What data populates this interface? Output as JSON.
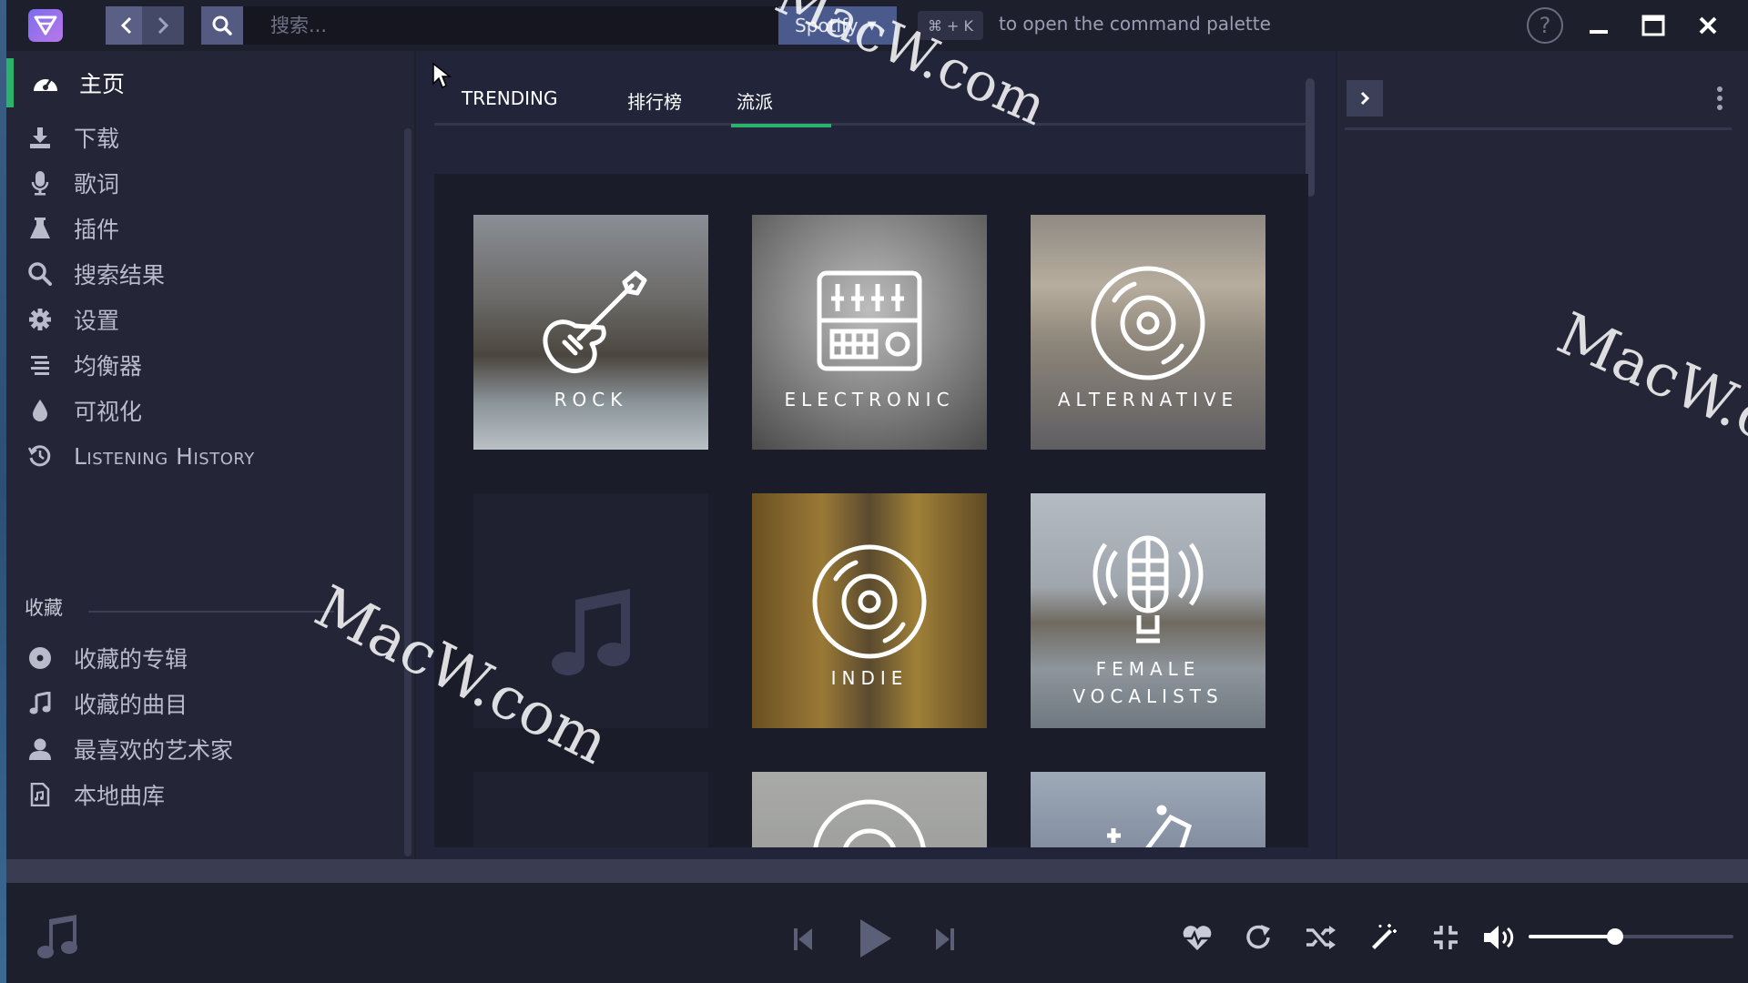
{
  "topbar": {
    "search_placeholder": "搜索...",
    "provider": "Spotify",
    "shortcut": "⌘ + K",
    "palette_hint": "to open the command palette",
    "help_symbol": "?"
  },
  "sidebar": {
    "items": [
      {
        "label": "主页",
        "icon": "dashboard-icon",
        "active": true
      },
      {
        "label": "下载",
        "icon": "download-icon"
      },
      {
        "label": "歌词",
        "icon": "microphone-icon"
      },
      {
        "label": "插件",
        "icon": "flask-icon"
      },
      {
        "label": "搜索结果",
        "icon": "search-icon"
      },
      {
        "label": "设置",
        "icon": "gear-icon"
      },
      {
        "label": "均衡器",
        "icon": "equalizer-icon"
      },
      {
        "label": "可视化",
        "icon": "droplet-icon"
      },
      {
        "label": "Listening History",
        "icon": "history-icon"
      }
    ],
    "favorites_header": "收藏",
    "favorites": [
      {
        "label": "收藏的专辑",
        "icon": "disc-icon"
      },
      {
        "label": "收藏的曲目",
        "icon": "music-note-icon"
      },
      {
        "label": "最喜欢的艺术家",
        "icon": "user-icon"
      },
      {
        "label": "本地曲库",
        "icon": "file-audio-icon"
      }
    ]
  },
  "tabs": [
    {
      "label": "TRENDING"
    },
    {
      "label": "排行榜"
    },
    {
      "label": "流派",
      "active": true
    }
  ],
  "genres": [
    {
      "label": "ROCK",
      "icon": "guitar-icon"
    },
    {
      "label": "ELECTRONIC",
      "icon": "mixer-icon"
    },
    {
      "label": "ALTERNATIVE",
      "icon": "vinyl-icon"
    },
    {
      "label": "INDIE",
      "icon": "vinyl-icon"
    },
    {
      "label": "FEMALE",
      "label2": "VOCALISTS",
      "icon": "microphone-icon"
    }
  ],
  "player": {
    "volume": 0.42
  },
  "colors": {
    "accent": "#2ab36b",
    "background": "#1e2030",
    "sidebar": "#242638"
  },
  "watermarks": [
    "MacW.com",
    "MacW.com",
    "MacW.c"
  ]
}
